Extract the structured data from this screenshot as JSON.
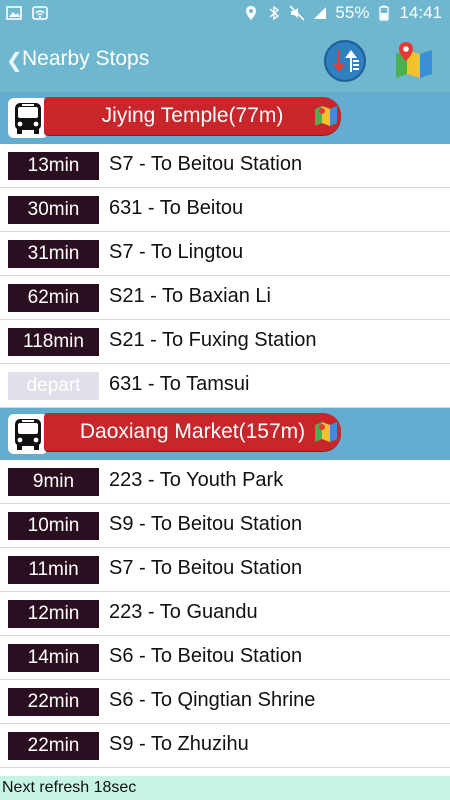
{
  "status_bar": {
    "battery": "55%",
    "time": "14:41"
  },
  "app_bar": {
    "title": "Nearby Stops",
    "icons": [
      "back-chevron",
      "sort-icon",
      "map-icon"
    ]
  },
  "colors": {
    "bar": "#6fb6cf",
    "group_header": "#63aed0",
    "stop_pill": "#c9262c",
    "eta_bg": "#2a0f20",
    "eta_depart_bg": "#e3dfea",
    "refresh_bg": "#c6f5e6"
  },
  "groups": [
    {
      "stop": "Jiying Temple(77m)",
      "rows": [
        {
          "eta": "13min",
          "route": "S7 - To Beitou Station"
        },
        {
          "eta": "30min",
          "route": "631 - To Beitou"
        },
        {
          "eta": "31min",
          "route": "S7 - To Lingtou"
        },
        {
          "eta": "62min",
          "route": "S21 - To Baxian Li"
        },
        {
          "eta": "118min",
          "route": "S21 - To Fuxing Station"
        },
        {
          "eta": "depart",
          "route": "631 - To Tamsui"
        }
      ]
    },
    {
      "stop": "Daoxiang Market(157m)",
      "rows": [
        {
          "eta": "9min",
          "route": "223 - To Youth Park"
        },
        {
          "eta": "10min",
          "route": "S9 - To Beitou Station"
        },
        {
          "eta": "11min",
          "route": "S7 - To Beitou Station"
        },
        {
          "eta": "12min",
          "route": "223 - To Guandu"
        },
        {
          "eta": "14min",
          "route": "S6 - To Beitou Station"
        },
        {
          "eta": "22min",
          "route": "S6 - To Qingtian Shrine"
        },
        {
          "eta": "22min",
          "route": "S9 - To Zhuzihu"
        }
      ]
    }
  ],
  "footer": {
    "refresh_text": "Next refresh 18sec"
  }
}
